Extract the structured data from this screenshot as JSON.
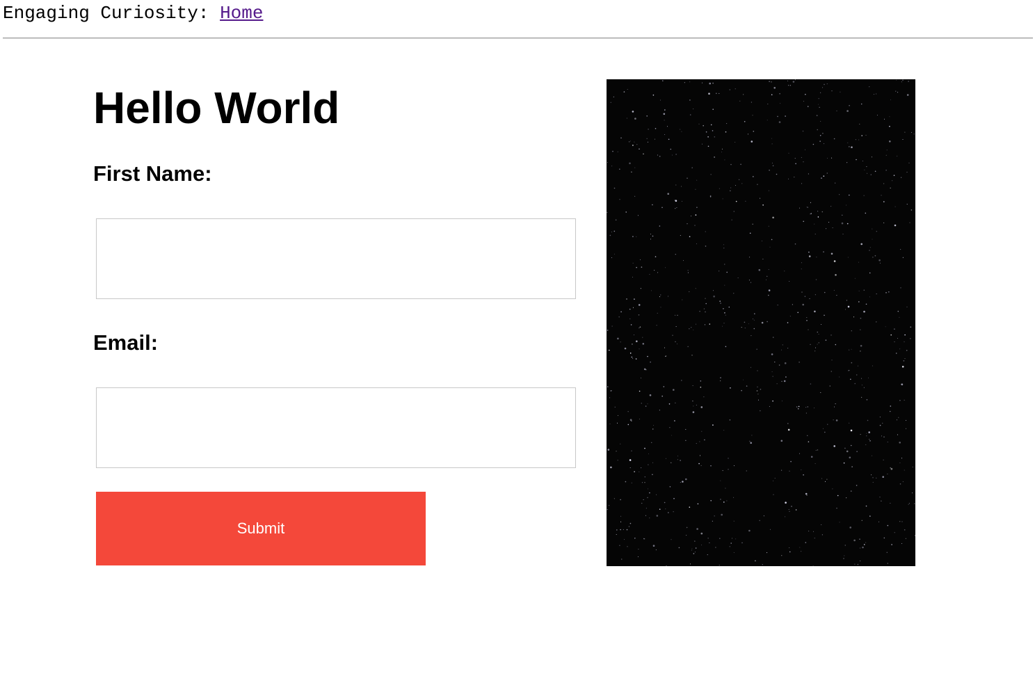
{
  "header": {
    "site_label": "Engaging Curiosity:",
    "home_link": "Home"
  },
  "main": {
    "title": "Hello World",
    "form": {
      "first_name_label": "First Name:",
      "first_name_value": "",
      "email_label": "Email:",
      "email_value": "",
      "submit_label": "Submit"
    },
    "image": {
      "alt": "starfield"
    }
  },
  "colors": {
    "link": "#551a8b",
    "submit_bg": "#f4483a",
    "image_bg": "#050505"
  }
}
